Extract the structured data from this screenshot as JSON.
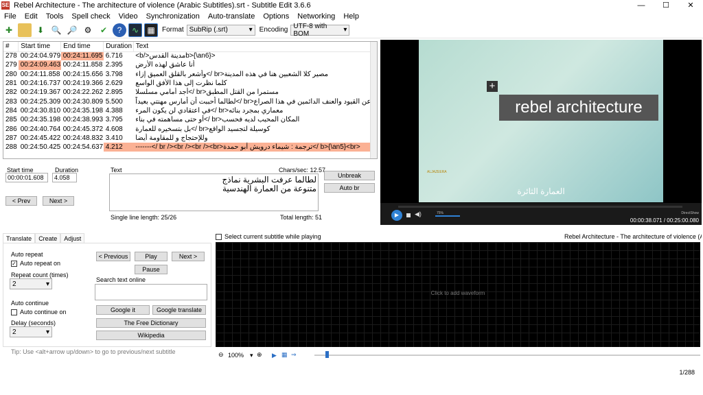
{
  "window": {
    "title": "Rebel Architecture - The architecture of violence (Arabic Subtitles).srt - Subtitle Edit 3.6.6",
    "icon": "SE"
  },
  "menu": [
    "File",
    "Edit",
    "Tools",
    "Spell check",
    "Video",
    "Synchronization",
    "Auto-translate",
    "Options",
    "Networking",
    "Help"
  ],
  "toolbar": {
    "format_label": "Format",
    "format_value": "SubRip (.srt)",
    "encoding_label": "Encoding",
    "encoding_value": "UTF-8 with BOM"
  },
  "grid": {
    "headers": [
      "#",
      "Start time",
      "End time",
      "Duration",
      "Text"
    ],
    "rows": [
      [
        "278",
        "00:24:04.979",
        "00:24:11.695",
        "6.716",
        "<b>{\\an6}مدينة القدس</b>"
      ],
      [
        "279",
        "00:24:09.463",
        "00:24:11.858",
        "2.395",
        "أنا عاشق لهذه الأرض"
      ],
      [
        "280",
        "00:24:11.858",
        "00:24:15.656",
        "3.798",
        "مصير كلا الشعبين هنا في هذه المدينة<br />وأشعر بالقلق العميق إزاء"
      ],
      [
        "281",
        "00:24:16.737",
        "00:24:19.366",
        "2.629",
        "كلما نظرت إلى هذا الأفق الواسع"
      ],
      [
        "282",
        "00:24:19.367",
        "00:24:22.262",
        "2.895",
        "مستمرا من القتل المطبق<br />أجد أمامي مسلسلا"
      ],
      [
        "283",
        "00:24:25.309",
        "00:24:30.809",
        "5.500",
        "عن القيود والعنف الدائمين في هذا الصراع<br />لطالما أحببت أن أمارس مهنتي بعيداً"
      ],
      [
        "284",
        "00:24:30.810",
        "00:24:35.198",
        "4.388",
        "معماري بمجرد بنائه<br />في اعتقادي لن يكون المرء"
      ],
      [
        "285",
        "00:24:35.198",
        "00:24:38.993",
        "3.795",
        "المكان المحبب لديه فحسب<br />أو حتى مساهمته في بناء"
      ],
      [
        "286",
        "00:24:40.764",
        "00:24:45.372",
        "4.608",
        "كوسيلة لتجسيد الواقع<br />بل بتسخيره للعمارة"
      ],
      [
        "287",
        "00:24:45.422",
        "00:24:48.832",
        "3.410",
        "وللإحتجاج و للمقاومة أيضا"
      ],
      [
        "288",
        "00:24:50.425",
        "00:24:54.637",
        "4.212",
        "<b>{\\an5}<br />ترجمة : شيماء درويش أبو حمدة<br /><br /><br /><br />-------"
      ]
    ]
  },
  "video": {
    "title_overlay": "rebel architecture",
    "subtitle": "العمارة الثائرة",
    "channel": "ALJAZEERA",
    "time": "00:00:38.071 / 00:25:00.080",
    "volume": "75%",
    "renderer": "DirectShow"
  },
  "edit": {
    "start_label": "Start time",
    "start_value": "00:00:01.608",
    "duration_label": "Duration",
    "duration_value": "4.058",
    "text_label": "Text",
    "chars_sec": "Chars/sec: 12.57",
    "text_line1": "لطالما عرفت البشرية نماذج",
    "text_line2": "متنوعة من العمارة الهندسية",
    "prev": "< Prev",
    "next": "Next >",
    "unbreak": "Unbreak",
    "autobr": "Auto br",
    "single_len": "Single line length: 25/26",
    "total_len": "Total length: 51"
  },
  "bottom": {
    "tabs": [
      "Translate",
      "Create",
      "Adjust"
    ],
    "auto_repeat": "Auto repeat",
    "auto_repeat_on": "Auto repeat on",
    "repeat_count": "Repeat count (times)",
    "repeat_value": "2",
    "auto_continue": "Auto continue",
    "auto_continue_on": "Auto continue on",
    "delay": "Delay (seconds)",
    "delay_value": "2",
    "previous": "< Previous",
    "play": "Play",
    "next": "Next >",
    "pause": "Pause",
    "search_label": "Search text online",
    "google_it": "Google it",
    "google_translate": "Google translate",
    "free_dictionary": "The Free Dictionary",
    "wikipedia": "Wikipedia",
    "tip": "Tip: Use <alt+arrow up/down> to go to previous/next subtitle"
  },
  "waveform": {
    "select_current": "Select current subtitle while playing",
    "file_title": "Rebel Architecture - The architecture of violence (Arabic",
    "click_to_add": "Click to add waveform",
    "zoom": "100%"
  },
  "status": {
    "position": "1/288"
  }
}
